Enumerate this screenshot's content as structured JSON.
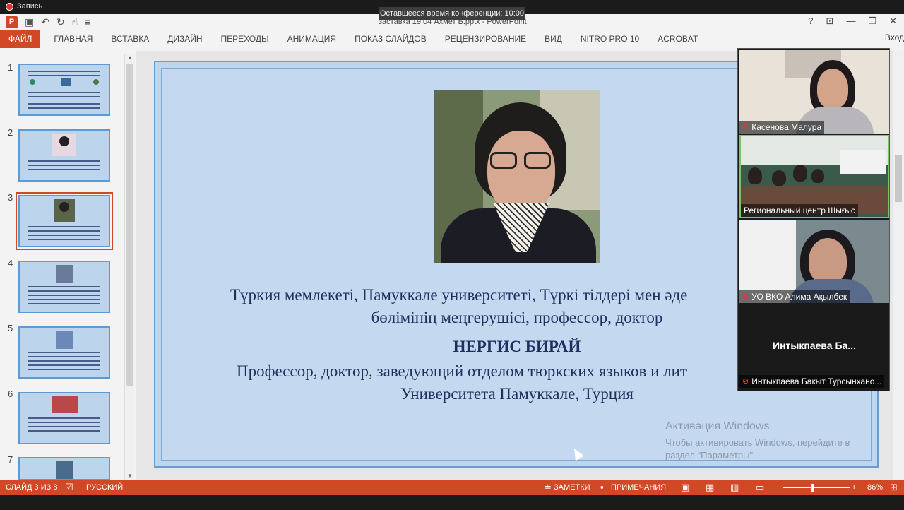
{
  "recording": {
    "label": "Запись"
  },
  "conference": {
    "timer": "Оставшееся время конференции: 10:00"
  },
  "window": {
    "title": "заставка 19.04 Ахмет Б.pptx - PowerPoint",
    "help": "?",
    "ribbon_display": "⊡",
    "minimize": "—",
    "restore": "❐",
    "close": "✕"
  },
  "qat": {
    "save": "▣",
    "undo": "↶",
    "redo": "↻",
    "touch": "☝",
    "customize": "≡"
  },
  "ribbon": {
    "tabs": [
      "ФАЙЛ",
      "ГЛАВНАЯ",
      "ВСТАВКА",
      "ДИЗАЙН",
      "ПЕРЕХОДЫ",
      "АНИМАЦИЯ",
      "ПОКАЗ СЛАЙДОВ",
      "РЕЦЕНЗИРОВАНИЕ",
      "ВИД",
      "NITRO PRO 10",
      "ACROBAT"
    ],
    "login": "Вход"
  },
  "thumbnails": {
    "numbers": [
      "1",
      "2",
      "3",
      "4",
      "5",
      "6",
      "7"
    ],
    "active_index": 3
  },
  "slide": {
    "kz_line1": "Түркия мемлекеті, Памуккале университеті, Түркі тілдері мен әде",
    "kz_line2": "бөлімінің меңгерушісі, профессор, доктор",
    "name": "НЕРГИС БИРАЙ",
    "ru_line1": "Профессор, доктор, заведующий отделом тюркских языков и лит",
    "ru_line2": "Университета Памуккале, Турция"
  },
  "activation": {
    "title": "Активация Windows",
    "subtitle": "Чтобы активировать Windows, перейдите в раздел \"Параметры\"."
  },
  "video": {
    "participants": [
      {
        "name": "Касенова Малура",
        "muted": true
      },
      {
        "name": "Региональный центр Шығыс",
        "muted": false
      },
      {
        "name": "УО ВКО Алима Ақылбек",
        "muted": true
      },
      {
        "name": "Интыкпаева Бакыт Турсынхано...",
        "muted": true,
        "display_name": "Интыкпаева  Ба..."
      }
    ]
  },
  "statusbar": {
    "slide_info": "СЛАЙД 3 ИЗ 8",
    "language": "РУССКИЙ",
    "notes": "ЗАМЕТКИ",
    "comments": "ПРИМЕЧАНИЯ",
    "zoom_minus": "−",
    "zoom_plus": "+",
    "zoom": "86%"
  },
  "colors": {
    "accent": "#d24726",
    "slide_bg": "#c4d9f0",
    "text": "#1f2f5e"
  }
}
